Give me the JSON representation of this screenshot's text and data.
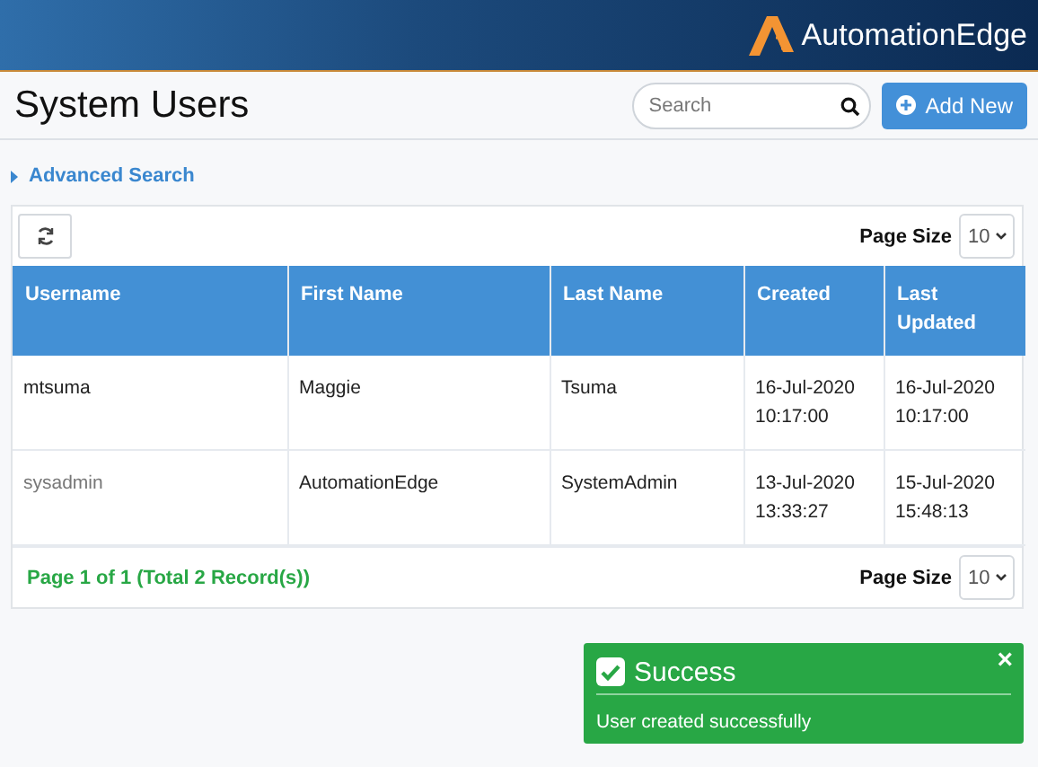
{
  "header": {
    "logo_text": "AutomationEdge"
  },
  "page": {
    "title": "System Users",
    "search": {
      "placeholder": "Search"
    },
    "add_button": "Add New"
  },
  "advanced_search": {
    "label": "Advanced Search",
    "expanded": false
  },
  "table": {
    "page_size_label": "Page Size",
    "page_size": "10",
    "columns": [
      "Username",
      "First Name",
      "Last Name",
      "Created",
      "Last Updated"
    ],
    "rows": [
      {
        "cells": [
          "mtsuma",
          "Maggie",
          "Tsuma",
          "16-Jul-2020 10:17:00",
          "16-Jul-2020 10:17:00"
        ],
        "disabled": false
      },
      {
        "cells": [
          "sysadmin",
          "AutomationEdge",
          "SystemAdmin",
          "13-Jul-2020 13:33:27",
          "15-Jul-2020 15:48:13"
        ],
        "disabled": true
      }
    ],
    "footer": {
      "summary": "Page 1 of 1 (Total 2 Record(s))",
      "page_size_label": "Page Size",
      "page_size": "10"
    }
  },
  "toast": {
    "title": "Success",
    "message": "User created successfully",
    "close": "×"
  }
}
